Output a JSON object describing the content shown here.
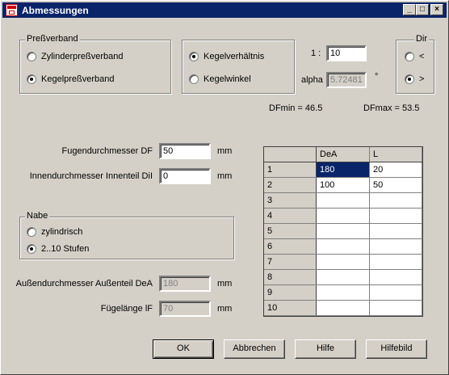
{
  "window": {
    "title": "Abmessungen"
  },
  "titlebar": {
    "minimize": "_",
    "maximize": "□",
    "close": "×"
  },
  "pressverband": {
    "legend": "Preßverband",
    "option1": "Zylinderpreßverband",
    "option2": "Kegelpreßverband",
    "selected": "option2"
  },
  "kegel": {
    "option1": "Kegelverhältnis",
    "option2": "Kegelwinkel",
    "selected": "option1"
  },
  "ratio": {
    "label": "1 :",
    "value": "10"
  },
  "alpha": {
    "label": "alpha",
    "value": "5.72481",
    "unit": "°"
  },
  "dir": {
    "legend": "Dir",
    "option1": "<",
    "option2": ">",
    "selected": "option2"
  },
  "dfmin": "DFmin = 46.5",
  "dfmax": "DFmax = 53.5",
  "fugen": {
    "label": "Fugendurchmesser DF",
    "value": "50",
    "unit": "mm"
  },
  "innen": {
    "label": "Innendurchmesser Innenteil DiI",
    "value": "0",
    "unit": "mm"
  },
  "nabe": {
    "legend": "Nabe",
    "option1": "zylindrisch",
    "option2": "2..10 Stufen",
    "selected": "option2"
  },
  "aussen": {
    "label": "Außendurchmesser Außenteil DeA",
    "value": "180",
    "unit": "mm"
  },
  "fuege": {
    "label": "Fügelänge lF",
    "value": "70",
    "unit": "mm"
  },
  "grid": {
    "headers": [
      "DeA",
      "L"
    ],
    "rows": [
      {
        "n": "1",
        "a": "180",
        "b": "20"
      },
      {
        "n": "2",
        "a": "100",
        "b": "50"
      },
      {
        "n": "3",
        "a": "",
        "b": ""
      },
      {
        "n": "4",
        "a": "",
        "b": ""
      },
      {
        "n": "5",
        "a": "",
        "b": ""
      },
      {
        "n": "6",
        "a": "",
        "b": ""
      },
      {
        "n": "7",
        "a": "",
        "b": ""
      },
      {
        "n": "8",
        "a": "",
        "b": ""
      },
      {
        "n": "9",
        "a": "",
        "b": ""
      },
      {
        "n": "10",
        "a": "",
        "b": ""
      }
    ]
  },
  "buttons": {
    "ok": "OK",
    "cancel": "Abbrechen",
    "help": "Hilfe",
    "helpimage": "Hilfebild"
  }
}
